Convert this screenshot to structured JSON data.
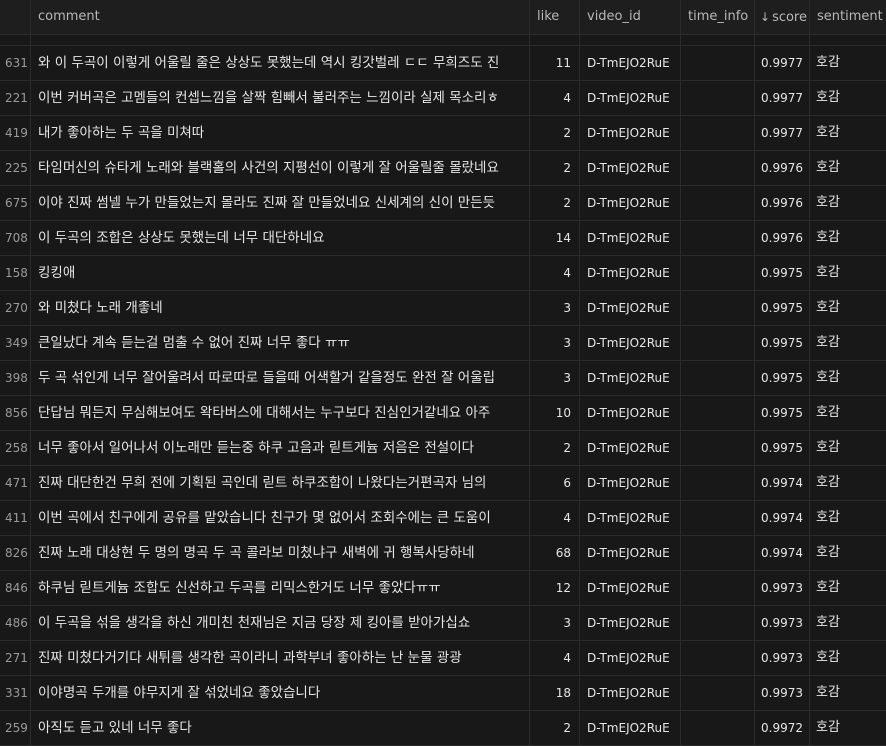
{
  "columns": {
    "index": "",
    "comment": "comment",
    "like": "like",
    "video_id": "video_id",
    "time_info": "time_info",
    "score": "score",
    "score_sort_icon": "↓",
    "sentiment": "sentiment"
  },
  "rows": [
    {
      "idx": "631",
      "comment": "와 이 두곡이 이렇게 어울릴 줄은 상상도 못했는데 역시 킹갓벌레 ㄷㄷ 무희즈도 진",
      "like": "11",
      "video_id": "D-TmEJO2RuE",
      "time_info": "",
      "score": "0.9977",
      "sentiment": "호감"
    },
    {
      "idx": "221",
      "comment": "이번 커버곡은 고멤들의 컨셉느낌을 살짝 힘빼서 불러주는 느낌이라 실제 목소리ㅎ",
      "like": "4",
      "video_id": "D-TmEJO2RuE",
      "time_info": "",
      "score": "0.9977",
      "sentiment": "호감"
    },
    {
      "idx": "419",
      "comment": "내가 좋아하는 두 곡을 미쳐따",
      "like": "2",
      "video_id": "D-TmEJO2RuE",
      "time_info": "",
      "score": "0.9977",
      "sentiment": "호감"
    },
    {
      "idx": "225",
      "comment": "타임머신의 슈타게 노래와 블랙홀의 사건의 지평선이 이렇게 잘 어울릴줄 몰랐네요",
      "like": "2",
      "video_id": "D-TmEJO2RuE",
      "time_info": "",
      "score": "0.9976",
      "sentiment": "호감"
    },
    {
      "idx": "675",
      "comment": "이야 진짜 썸넬 누가 만들었는지 몰라도 진짜 잘 만들었네요 신세계의 신이 만든듯",
      "like": "2",
      "video_id": "D-TmEJO2RuE",
      "time_info": "",
      "score": "0.9976",
      "sentiment": "호감"
    },
    {
      "idx": "708",
      "comment": "이 두곡의 조합은 상상도 못했는데 너무 대단하네요",
      "like": "14",
      "video_id": "D-TmEJO2RuE",
      "time_info": "",
      "score": "0.9976",
      "sentiment": "호감"
    },
    {
      "idx": "158",
      "comment": "킹킹애",
      "like": "4",
      "video_id": "D-TmEJO2RuE",
      "time_info": "",
      "score": "0.9975",
      "sentiment": "호감"
    },
    {
      "idx": "270",
      "comment": "와 미쳤다 노래 개좋네",
      "like": "3",
      "video_id": "D-TmEJO2RuE",
      "time_info": "",
      "score": "0.9975",
      "sentiment": "호감"
    },
    {
      "idx": "349",
      "comment": "큰일났다 계속 듣는걸 멈출 수 없어 진짜 너무 좋다 ㅠㅠ",
      "like": "3",
      "video_id": "D-TmEJO2RuE",
      "time_info": "",
      "score": "0.9975",
      "sentiment": "호감"
    },
    {
      "idx": "398",
      "comment": "두 곡 섞인게 너무 잘어울려서 따로따로 들을때 어색할거 같을정도 완전 잘 어울립",
      "like": "3",
      "video_id": "D-TmEJO2RuE",
      "time_info": "",
      "score": "0.9975",
      "sentiment": "호감"
    },
    {
      "idx": "856",
      "comment": "단답님 뭐든지 무심해보여도 왁타버스에 대해서는 누구보다 진심인거같네요 아주",
      "like": "10",
      "video_id": "D-TmEJO2RuE",
      "time_info": "",
      "score": "0.9975",
      "sentiment": "호감"
    },
    {
      "idx": "258",
      "comment": "너무 좋아서 일어나서 이노래만 듣는중 하쿠 고음과 릳트게늄 저음은 전설이다",
      "like": "2",
      "video_id": "D-TmEJO2RuE",
      "time_info": "",
      "score": "0.9975",
      "sentiment": "호감"
    },
    {
      "idx": "471",
      "comment": "진짜 대단한건 무희 전에 기획된 곡인데 릳트 하쿠조합이 나왔다는거편곡자 님의",
      "like": "6",
      "video_id": "D-TmEJO2RuE",
      "time_info": "",
      "score": "0.9974",
      "sentiment": "호감"
    },
    {
      "idx": "411",
      "comment": "이번 곡에서 친구에게 공유를 맡았습니다 친구가 몇 없어서 조회수에는 큰 도움이",
      "like": "4",
      "video_id": "D-TmEJO2RuE",
      "time_info": "",
      "score": "0.9974",
      "sentiment": "호감"
    },
    {
      "idx": "826",
      "comment": "진짜 노래 대상현 두 명의 명곡 두 곡 콜라보 미쳤냐구 새벽에 귀 행복사당하네",
      "like": "68",
      "video_id": "D-TmEJO2RuE",
      "time_info": "",
      "score": "0.9974",
      "sentiment": "호감"
    },
    {
      "idx": "846",
      "comment": "하쿠님 릳트게늄 조합도 신선하고 두곡를 리믹스한거도 너무 좋았다ㅠㅠ",
      "like": "12",
      "video_id": "D-TmEJO2RuE",
      "time_info": "",
      "score": "0.9973",
      "sentiment": "호감"
    },
    {
      "idx": "486",
      "comment": "이 두곡을 섞을 생각을 하신 개미친 천재님은 지금 당장 제 킹아를 받아가십쇼",
      "like": "3",
      "video_id": "D-TmEJO2RuE",
      "time_info": "",
      "score": "0.9973",
      "sentiment": "호감"
    },
    {
      "idx": "271",
      "comment": "진짜 미쳤다거기다 새튀를 생각한 곡이라니 과학부녀 좋아하는 난 눈물 광광",
      "like": "4",
      "video_id": "D-TmEJO2RuE",
      "time_info": "",
      "score": "0.9973",
      "sentiment": "호감"
    },
    {
      "idx": "331",
      "comment": "이야명곡 두개를 야무지게 잘 섞었네요 좋았습니다",
      "like": "18",
      "video_id": "D-TmEJO2RuE",
      "time_info": "",
      "score": "0.9973",
      "sentiment": "호감"
    },
    {
      "idx": "259",
      "comment": "아직도 듣고 있네 너무 좋다",
      "like": "2",
      "video_id": "D-TmEJO2RuE",
      "time_info": "",
      "score": "0.9972",
      "sentiment": "호감"
    }
  ]
}
